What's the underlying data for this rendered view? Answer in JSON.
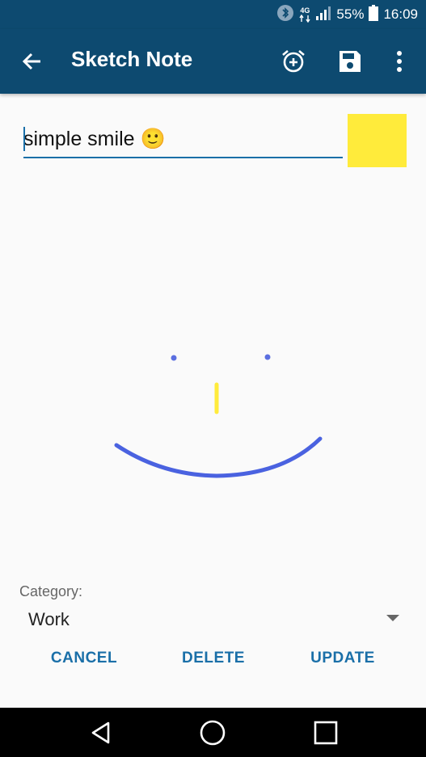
{
  "status_bar": {
    "network_label": "4G",
    "battery_percent": "55%",
    "time": "16:09",
    "icons": [
      "bluetooth-icon",
      "network-icon",
      "signal-icon",
      "battery-icon"
    ]
  },
  "app_bar": {
    "title": "Sketch Note",
    "back_icon": "arrow-back-icon",
    "alarm_icon": "alarm-add-icon",
    "save_icon": "save-icon",
    "more_icon": "more-vert-icon"
  },
  "note": {
    "title_value": "simple smile 🙂",
    "color": "#ffeb3b"
  },
  "sketch": {
    "left_eye_color": "#5b6fe0",
    "right_eye_color": "#5b6fe0",
    "nose_color": "#ffeb3b",
    "mouth_color": "#4a62e0"
  },
  "category": {
    "label": "Category:",
    "selected": "Work"
  },
  "actions": {
    "cancel": "CANCEL",
    "delete": "DELETE",
    "update": "UPDATE"
  },
  "colors": {
    "primary": "#0d4a70",
    "accent": "#1a6fa8"
  }
}
